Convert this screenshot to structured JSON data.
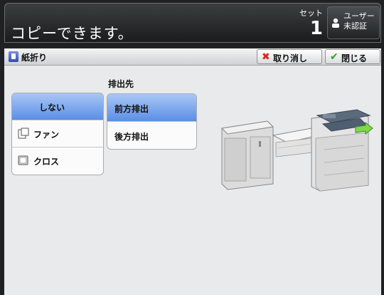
{
  "status": {
    "message": "コピーできます。",
    "set_label": "セット",
    "set_count": "1",
    "user_button": {
      "line1": "ユーザー",
      "line2": "未認証"
    }
  },
  "titlebar": {
    "title": "紙折り",
    "cancel_label": "取り消し",
    "close_label": "閉じる"
  },
  "fold_options": [
    {
      "label": "しない",
      "selected": true,
      "icon": ""
    },
    {
      "label": "ファン",
      "selected": false,
      "icon": "fan-fold-icon"
    },
    {
      "label": "クロス",
      "selected": false,
      "icon": "cross-fold-icon"
    }
  ],
  "destination": {
    "title": "排出先",
    "options": [
      {
        "label": "前方排出",
        "selected": true
      },
      {
        "label": "後方排出",
        "selected": false
      }
    ]
  },
  "colors": {
    "selected_top": "#a9c7f5",
    "selected_bottom": "#5b8ee6",
    "status_bg": "#1a1c1d",
    "panel_bg": "#e9eaeb",
    "cancel_red": "#d6281c",
    "ok_green": "#3a9a2a"
  }
}
